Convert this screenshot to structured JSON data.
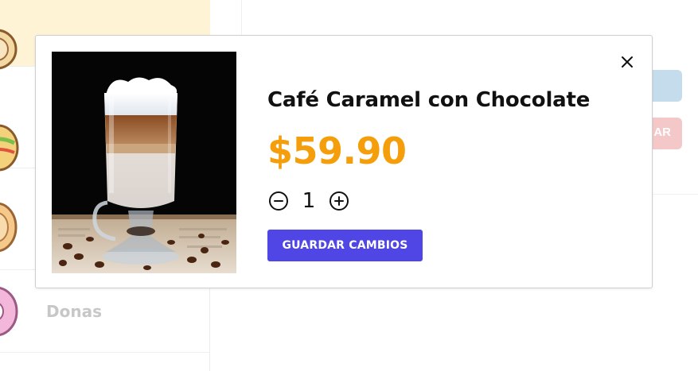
{
  "background": {
    "sidebar": {
      "categories": [
        {
          "label": ""
        },
        {
          "label": ""
        },
        {
          "label": ""
        },
        {
          "label": "Donas"
        }
      ]
    },
    "right_panel": {
      "red_button_label_fragment": "AR"
    }
  },
  "modal": {
    "product": {
      "name": "Café Caramel con Chocolate",
      "price": "$59.90",
      "image_alt_icon": "coffee-glass-image"
    },
    "quantity": {
      "value": "1",
      "decrement_icon": "minus-circle-icon",
      "increment_icon": "plus-circle-icon"
    },
    "save_label": "GUARDAR CAMBIOS",
    "close_icon": "close-icon"
  },
  "colors": {
    "accent_price": "#f59e0b",
    "primary_button": "#4f46e5",
    "active_category_bg": "#fff3d6",
    "ghost_blue": "#c5dcec",
    "ghost_red": "#f4c8c8"
  }
}
